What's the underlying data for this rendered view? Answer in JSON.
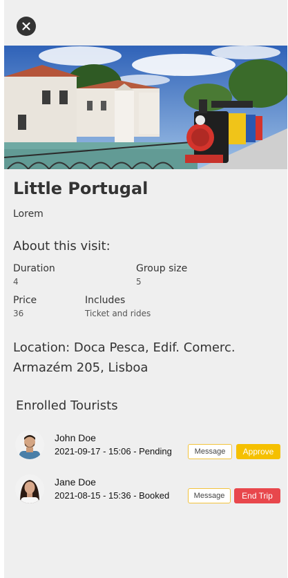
{
  "close_icon": "close-icon",
  "tour": {
    "title": "Little Portugal",
    "subtitle": "Lorem"
  },
  "about": {
    "heading": "About this visit:",
    "duration_label": "Duration",
    "duration_value": "4",
    "group_size_label": "Group size",
    "group_size_value": "5",
    "price_label": "Price",
    "price_value": "36",
    "includes_label": "Includes",
    "includes_value": "Ticket and rides"
  },
  "location": {
    "line1": "Location: Doca Pesca, Edif. Comerc.",
    "line2": "Armazém 205, Lisboa"
  },
  "enrolled": {
    "heading": "Enrolled Tourists",
    "tourists": [
      {
        "name": "John Doe",
        "info": "2021-09-17 - 15:06 - Pending",
        "message_label": "Message",
        "action_label": "Approve"
      },
      {
        "name": "Jane Doe",
        "info": "2021-08-15 - 15:36 - Booked",
        "message_label": "Message",
        "action_label": "End Trip"
      }
    ]
  },
  "colors": {
    "approve": "#f5c000",
    "end_trip": "#e8474c",
    "message_border": "#f2c23a",
    "background": "#efefef"
  }
}
